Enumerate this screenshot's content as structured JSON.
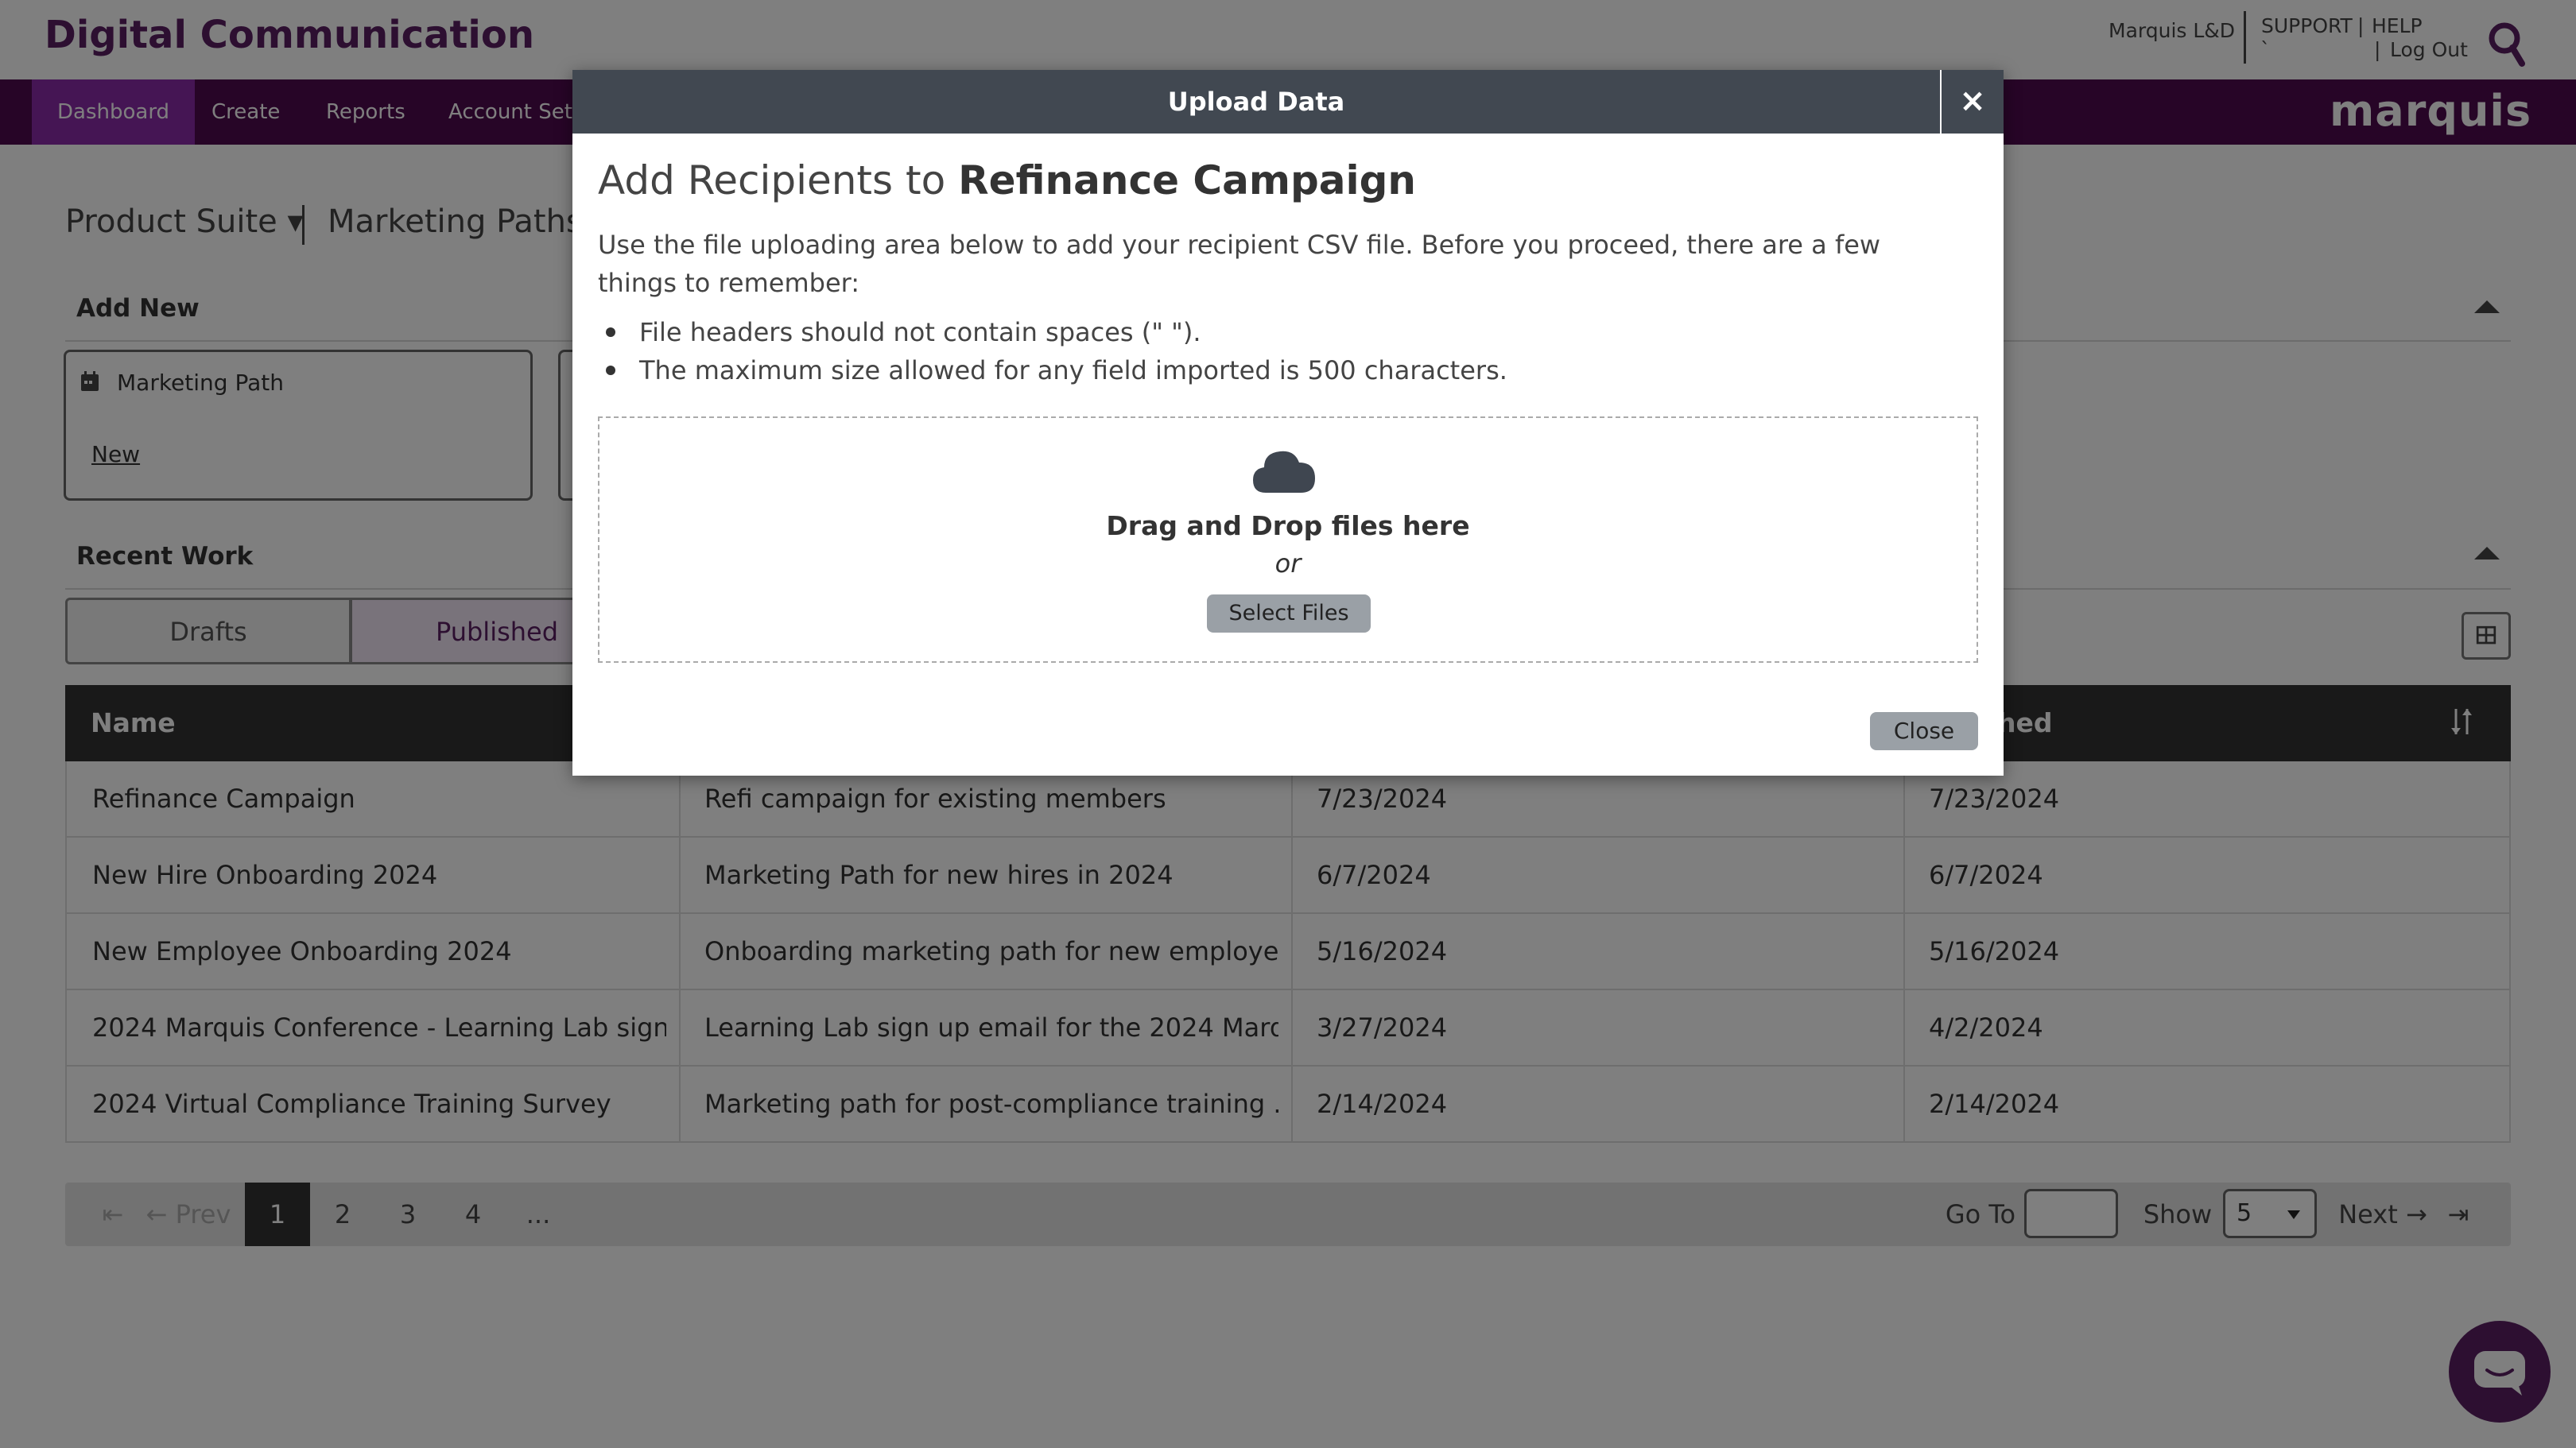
{
  "header": {
    "brand": "Digital Communication",
    "user": "Marquis L&D",
    "support": "SUPPORT",
    "separator": "|",
    "help": "HELP",
    "tick": "`",
    "logout_sep": "|",
    "logout": "Log Out"
  },
  "navbar": {
    "items": [
      "Dashboard",
      "Create",
      "Reports",
      "Account Sett"
    ],
    "logo": "marquis"
  },
  "subnav": {
    "product_suite": "Product Suite ▾",
    "marketing_paths": "Marketing Paths ▾"
  },
  "add_new": {
    "title": "Add New",
    "card_title": "Marketing Path",
    "card_link": "New"
  },
  "recent_work": {
    "title": "Recent Work",
    "tabs": [
      "Drafts",
      "Published"
    ],
    "columns": [
      "Name",
      "",
      "",
      "hed"
    ],
    "rows": [
      [
        "Refinance Campaign",
        "Refi campaign for existing members",
        "7/23/2024",
        "7/23/2024"
      ],
      [
        "New Hire Onboarding 2024",
        "Marketing Path for new hires in 2024",
        "6/7/2024",
        "6/7/2024"
      ],
      [
        "New Employee Onboarding 2024",
        "Onboarding marketing path for new employe...",
        "5/16/2024",
        "5/16/2024"
      ],
      [
        "2024 Marquis Conference - Learning Lab sign...",
        "Learning Lab sign up email for the 2024 Marq...",
        "3/27/2024",
        "4/2/2024"
      ],
      [
        "2024 Virtual Compliance Training Survey",
        "Marketing path for post-compliance training ...",
        "2/14/2024",
        "2/14/2024"
      ]
    ]
  },
  "pager": {
    "first": "⇤",
    "prev": "← Prev",
    "pages": [
      "1",
      "2",
      "3",
      "4",
      "..."
    ],
    "goto_label": "Go To",
    "goto_value": "",
    "show_label": "Show",
    "show_value": "5",
    "next": "Next →",
    "last": "⇥"
  },
  "modal": {
    "title": "Upload Data",
    "close_x": "×",
    "heading_prefix": "Add Recipients to ",
    "heading_bold": "Refinance Campaign",
    "intro": "Use the file uploading area below to add your recipient CSV file. Before you proceed, there are a few things to remember:",
    "bullets": [
      "File headers should not contain spaces (\" \").",
      "The maximum size allowed for any field imported is 500 characters."
    ],
    "dropzone_title": "Drag and Drop files here",
    "dropzone_or": "or",
    "select_files": "Select Files",
    "close": "Close"
  },
  "colors": {
    "brand": "#5b1f63",
    "navbar": "#4e0a4e",
    "nav_active": "#8b2ba8",
    "modal_header": "#414851"
  }
}
